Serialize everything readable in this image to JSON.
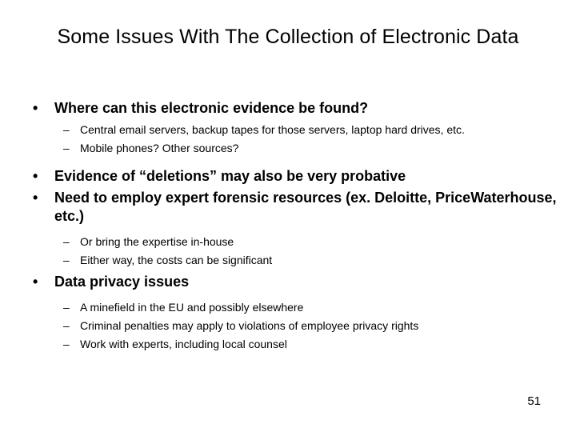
{
  "slide": {
    "title": "Some Issues With The Collection of Electronic Data",
    "page_number": "51",
    "background_color": "#ffffff",
    "text_color": "#000000",
    "bullet_marker": "•",
    "dash_marker": "–"
  },
  "content": {
    "groups": [
      {
        "lvl1": "Where can this electronic evidence be found?",
        "lvl2": [
          "Central email servers, backup tapes for those servers, laptop hard drives, etc.",
          "Mobile phones?  Other sources?"
        ]
      },
      {
        "lvl1": "Evidence of “deletions” may also be very probative",
        "lvl2": []
      },
      {
        "lvl1": "Need to employ expert forensic resources (ex. Deloitte, PriceWaterhouse, etc.)",
        "lvl2": [
          "Or bring the expertise in-house",
          "Either way, the costs can be significant"
        ]
      },
      {
        "lvl1": "Data privacy issues",
        "lvl2": [
          "A minefield in the EU and possibly elsewhere",
          "Criminal penalties may apply to violations of employee privacy rights",
          "Work with experts, including local counsel"
        ]
      }
    ]
  }
}
